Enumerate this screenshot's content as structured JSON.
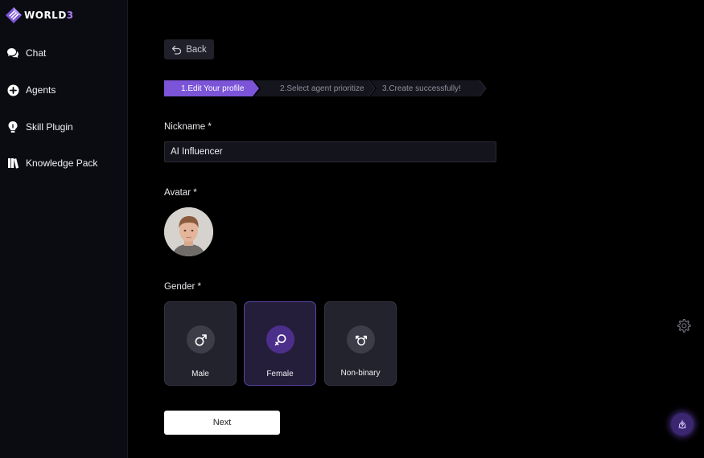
{
  "app": {
    "logo_text": "WORLD",
    "logo_text_accent": "3",
    "accent_color": "#7b54d8"
  },
  "sidebar": {
    "items": [
      {
        "label": "Chat",
        "icon": "chat-bubbles-icon"
      },
      {
        "label": "Agents",
        "icon": "plus-circle-icon"
      },
      {
        "label": "Skill Plugin",
        "icon": "lightbulb-icon"
      },
      {
        "label": "Knowledge Pack",
        "icon": "books-icon"
      }
    ]
  },
  "main": {
    "back_label": "Back",
    "steps": [
      {
        "label": "1.Edit Your profile",
        "active": true
      },
      {
        "label": "2.Select agent prioritize",
        "active": false
      },
      {
        "label": "3.Create successfully!",
        "active": false
      }
    ],
    "nickname": {
      "label": "Nickname *",
      "value": "AI Influencer"
    },
    "avatar": {
      "label": "Avatar *"
    },
    "gender": {
      "label": "Gender *",
      "options": [
        {
          "label": "Male",
          "icon": "male-symbol-icon",
          "selected": false
        },
        {
          "label": "Female",
          "icon": "female-symbol-icon",
          "selected": true
        },
        {
          "label": "Non-binary",
          "icon": "non-binary-symbol-icon",
          "selected": false
        }
      ]
    },
    "next_label": "Next"
  },
  "floating": {
    "settings_icon": "gear-icon",
    "help_icon": "help-question-icon"
  }
}
